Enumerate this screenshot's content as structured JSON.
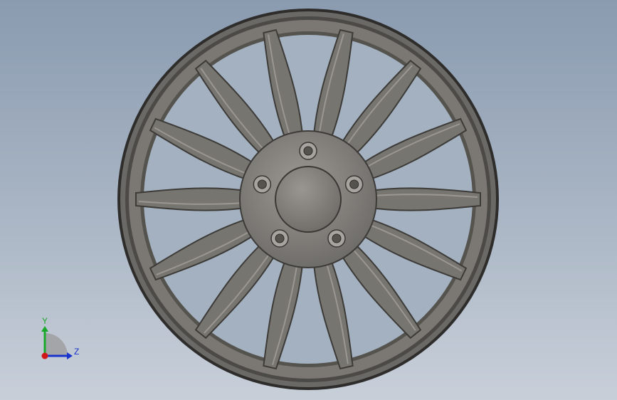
{
  "viewport": {
    "background_top": "#8a9bb0",
    "background_bottom": "#c8cfd9"
  },
  "model": {
    "type": "alloy wheel",
    "spoke_count": 14,
    "lug_hole_count": 5,
    "colors": {
      "rim_outer": "#2b2b2b",
      "rim_face": "#6e6c69",
      "rim_face_light": "#8c8984",
      "barrel_inner": "#57554f",
      "spoke_fill": "#777570",
      "spoke_edge": "#3d3b38",
      "hub": "#868380",
      "cap": "#7f7c78"
    }
  },
  "triad": {
    "y_label": "Y",
    "z_label": "Z",
    "y_color": "#1aa82a",
    "z_color": "#1a33cc",
    "x_color": "#d01818"
  }
}
